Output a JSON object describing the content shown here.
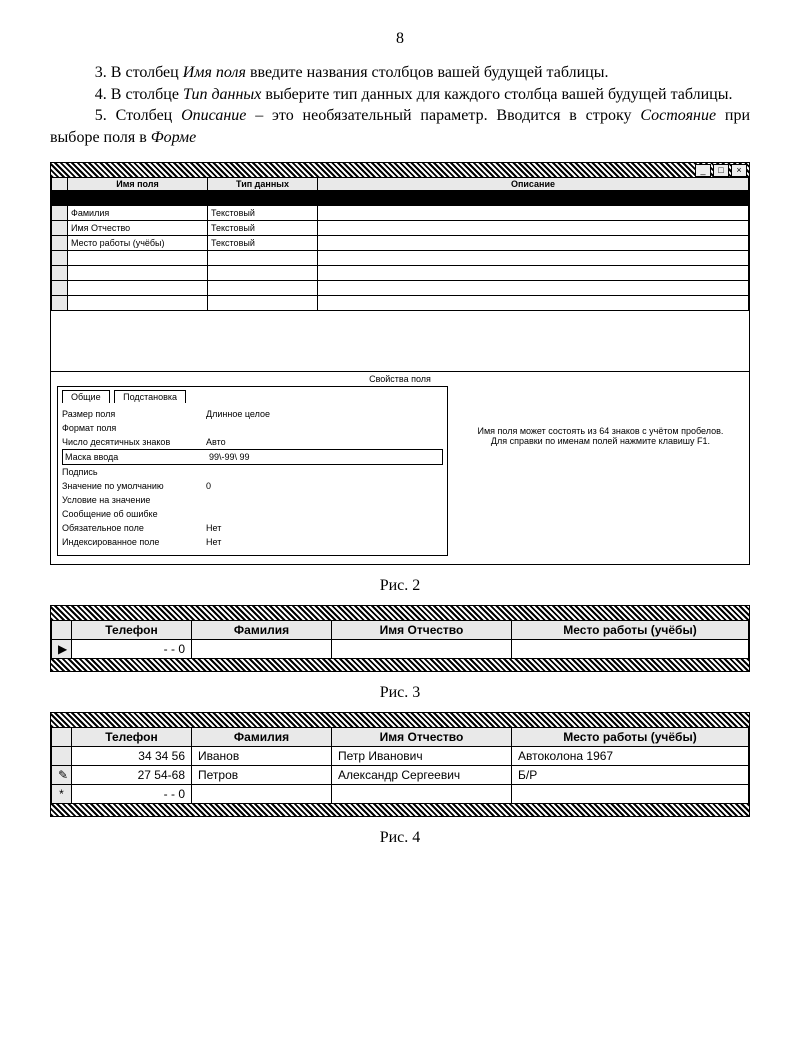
{
  "page_number": "8",
  "paragraphs": {
    "p3_a": "3. В столбец ",
    "p3_i": "Имя поля",
    "p3_b": " введите названия столбцов вашей будущей таблицы.",
    "p4_a": "4. В столбце ",
    "p4_i": "Тип данных",
    "p4_b": " выберите тип данных для каждого столбца вашей будущей таблицы.",
    "p5_a": "5. Столбец ",
    "p5_i1": "Описание",
    "p5_b": " – это необязательный параметр. Вводится в строку ",
    "p5_i2": "Состояние",
    "p5_c": " при выборе поля в ",
    "p5_i3": "Форме"
  },
  "fig2": {
    "headers": {
      "name": "Имя поля",
      "type": "Тип данных",
      "desc": "Описание"
    },
    "rows": [
      {
        "name": "Фамилия",
        "type": "Текстовый"
      },
      {
        "name": "Имя Отчество",
        "type": "Текстовый"
      },
      {
        "name": "Место работы (учёбы)",
        "type": "Текстовый"
      }
    ],
    "props_label": "Свойства поля",
    "tabs": {
      "general": "Общие",
      "lookup": "Подстановка"
    },
    "props": {
      "size": {
        "l": "Размер поля",
        "v": "Длинное целое"
      },
      "format": {
        "l": "Формат поля",
        "v": ""
      },
      "decimals": {
        "l": "Число десятичных знаков",
        "v": "Авто"
      },
      "mask": {
        "l": "Маска ввода",
        "v": "99\\-99\\ 99"
      },
      "caption": {
        "l": "Подпись",
        "v": ""
      },
      "default": {
        "l": "Значение по умолчанию",
        "v": "0"
      },
      "validrule": {
        "l": "Условие на значение",
        "v": ""
      },
      "validmsg": {
        "l": "Сообщение об ошибке",
        "v": ""
      },
      "required": {
        "l": "Обязательное поле",
        "v": "Нет"
      },
      "indexed": {
        "l": "Индексированное поле",
        "v": "Нет"
      }
    },
    "hint": "Имя поля может состоять из 64 знаков с учётом пробелов. Для справки по именам полей нажмите клавишу F1.",
    "caption": "Рис. 2"
  },
  "fig3": {
    "headers": {
      "tel": "Телефон",
      "fam": "Фамилия",
      "imy": "Имя Отчество",
      "work": "Место работы (учёбы)"
    },
    "rows": [
      {
        "marker": "▶",
        "tel": "- - 0",
        "fam": "",
        "imy": "",
        "work": ""
      }
    ],
    "caption": "Рис. 3"
  },
  "fig4": {
    "headers": {
      "tel": "Телефон",
      "fam": "Фамилия",
      "imy": "Имя Отчество",
      "work": "Место работы (учёбы)"
    },
    "rows": [
      {
        "marker": "",
        "tel": "34 34 56",
        "fam": "Иванов",
        "imy": "Петр Иванович",
        "work": "Автоколона 1967"
      },
      {
        "marker": "✎",
        "tel": "27 54-68",
        "fam": "Петров",
        "imy": "Александр Сергеевич",
        "work": "Б/Р"
      },
      {
        "marker": "*",
        "tel": "- - 0",
        "fam": "",
        "imy": "",
        "work": ""
      }
    ],
    "caption": "Рис. 4"
  }
}
